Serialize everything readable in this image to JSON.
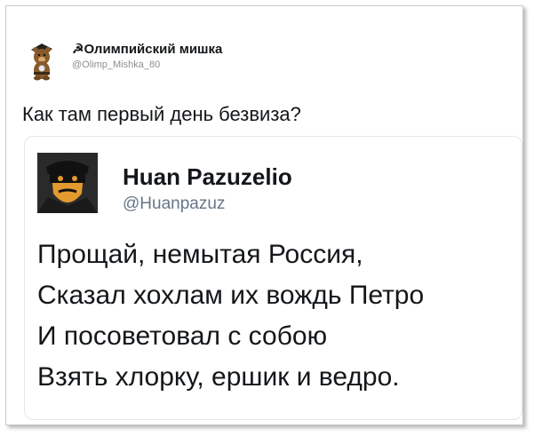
{
  "tweet": {
    "author_name": "Олимпийский мишка",
    "author_handle": "@Olimp_Mishka_80",
    "text": "Как там первый день безвиза?"
  },
  "quoted_tweet": {
    "author_name": "Huan Pazuzelio",
    "author_handle": "@Huanpazuz",
    "lines": [
      "Прощай, немытая Россия,",
      "Сказал хохлам их вождь Петро",
      "И посоветовал с собою",
      "Взять хлорку, ершик и ведро."
    ]
  },
  "colors": {
    "text": "#14171a",
    "handle": "#657786",
    "card_border": "#e1e8ed",
    "accent": "#f5a623"
  },
  "icons": {
    "author_avatar": "bear-mascot-avatar",
    "quote_avatar": "masked-face-avatar",
    "name_prefix": "hammer-sickle-icon"
  }
}
